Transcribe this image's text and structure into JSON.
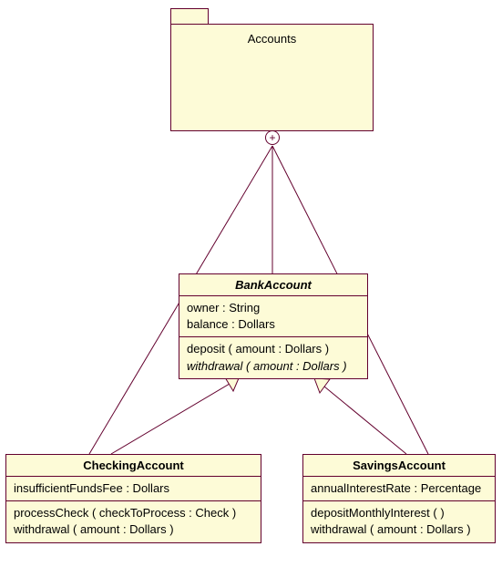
{
  "package": {
    "name": "Accounts"
  },
  "classes": {
    "bank": {
      "name": "BankAccount",
      "attrs": [
        "owner : String",
        "balance : Dollars"
      ],
      "ops": [
        {
          "text": "deposit ( amount : Dollars )",
          "italic": false
        },
        {
          "text": "withdrawal ( amount : Dollars )",
          "italic": true
        }
      ]
    },
    "checking": {
      "name": "CheckingAccount",
      "attrs": [
        "insufficientFundsFee : Dollars"
      ],
      "ops": [
        {
          "text": "processCheck ( checkToProcess : Check )",
          "italic": false
        },
        {
          "text": "withdrawal ( amount : Dollars )",
          "italic": false
        }
      ]
    },
    "savings": {
      "name": "SavingsAccount",
      "attrs": [
        "annualInterestRate : Percentage"
      ],
      "ops": [
        {
          "text": "depositMonthlyInterest (  )",
          "italic": false
        },
        {
          "text": "withdrawal ( amount : Dollars )",
          "italic": false
        }
      ]
    }
  },
  "colors": {
    "fill": "#FDFBD7",
    "stroke": "#63002E"
  }
}
